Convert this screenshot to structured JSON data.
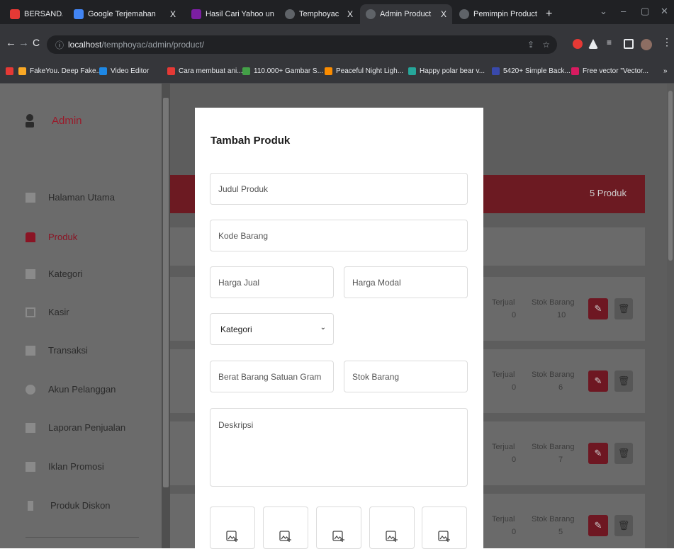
{
  "browser": {
    "tabs": [
      {
        "title": "BERSANDARLA",
        "close": "X",
        "color": "#e53935"
      },
      {
        "title": "Google Terjemahan",
        "close": "X",
        "color": "#4285f4"
      },
      {
        "title": "Hasil Cari Yahoo un",
        "close": "X",
        "color": "#7b1fa2"
      },
      {
        "title": "Temphoyac",
        "close": "X",
        "color": "#5f6368"
      },
      {
        "title": "Admin Product",
        "close": "X",
        "color": "#5f6368"
      },
      {
        "title": "Pemimpin Product",
        "close": "X",
        "color": "#5f6368"
      }
    ],
    "new_tab": "+",
    "url_host": "localhost",
    "url_path": "/temphoyac/admin/product/",
    "bookmarks": [
      {
        "label": "FakeYou. Deep Fake...",
        "color": "#f9a825"
      },
      {
        "label": "Video Editor",
        "color": "#1e88e5"
      },
      {
        "label": "Cara membuat ani...",
        "color": "#e53935"
      },
      {
        "label": "110.000+ Gambar S...",
        "color": "#43a047"
      },
      {
        "label": "Peaceful Night Ligh...",
        "color": "#fb8c00"
      },
      {
        "label": "Happy polar bear v...",
        "color": "#26a69a"
      },
      {
        "label": "5420+ Simple Back...",
        "color": "#3949ab"
      },
      {
        "label": "Free vector \"Vector...",
        "color": "#d81b60"
      }
    ],
    "bookmarks_more": "»"
  },
  "sidebar": {
    "brand": "Admin",
    "items": [
      {
        "label": "Halaman Utama",
        "icon": "grid-icon"
      },
      {
        "label": "Produk",
        "icon": "bag-icon",
        "active": true
      },
      {
        "label": "Kategori",
        "icon": "list-icon"
      },
      {
        "label": "Kasir",
        "icon": "monitor-icon"
      },
      {
        "label": "Transaksi",
        "icon": "lock-icon"
      },
      {
        "label": "Akun Pelanggan",
        "icon": "users-icon"
      },
      {
        "label": "Laporan Penjualan",
        "icon": "bank-icon"
      },
      {
        "label": "Iklan Promosi",
        "icon": "flag-icon"
      },
      {
        "label": "Produk Diskon",
        "icon": "bolt-icon"
      }
    ]
  },
  "main": {
    "product_count": "5 Produk",
    "rows": [
      {
        "sold_label": "Terjual",
        "sold": "0",
        "stock_label": "Stok Barang",
        "stock": "10"
      },
      {
        "sold_label": "Terjual",
        "sold": "0",
        "stock_label": "Stok Barang",
        "stock": "6"
      },
      {
        "sold_label": "Terjual",
        "sold": "0",
        "stock_label": "Stok Barang",
        "stock": "7"
      },
      {
        "sold_label": "Terjual",
        "sold": "0",
        "stock_label": "Stok Barang",
        "stock": "5"
      }
    ]
  },
  "modal": {
    "title": "Tambah Produk",
    "title_placeholder": "Judul Produk",
    "code_placeholder": "Kode Barang",
    "sell_price_placeholder": "Harga Jual",
    "cost_price_placeholder": "Harga Modal",
    "category_value": "Kategori",
    "weight_placeholder": "Berat Barang Satuan Gram",
    "stock_placeholder": "Stok Barang",
    "description_placeholder": "Deskripsi",
    "image_slots": 5
  },
  "colors": {
    "accent": "#8a1424",
    "overlay": "#5d5d5d"
  }
}
